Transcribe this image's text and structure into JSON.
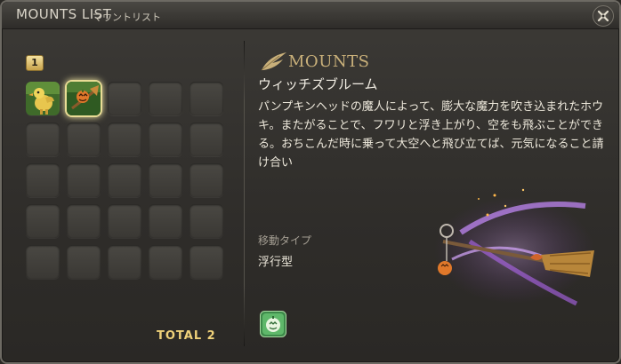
{
  "window": {
    "title_en": "MOUNTS LIST",
    "title_jp": "マウントリスト",
    "close_icon": "close-icon"
  },
  "list": {
    "page_number": "1",
    "total_label": "TOTAL",
    "total_count": "2",
    "slots_filled": [
      {
        "icon": "chocobo-mount-icon"
      },
      {
        "icon": "witch-broom-mount-icon",
        "selected": true
      }
    ],
    "slot_count": 25
  },
  "detail": {
    "category": "MOUNTS",
    "name": "ウィッチズブルーム",
    "description": "パンプキンヘッドの魔人によって、膨大な魔力を吹き込まれたホウキ。またがることで、フワリと浮き上がり、空をも飛ぶことができる。おちこんだ時に乗って大空へと飛び立てば、元気になること請け合い",
    "movement_type_label": "移動タイプ",
    "movement_type_value": "浮行型",
    "action_icon": "summon-mount-icon"
  },
  "colors": {
    "accent_gold": "#f0d27a",
    "category_gold": "#c9b07a",
    "selection_glow": "#e9dc95"
  }
}
